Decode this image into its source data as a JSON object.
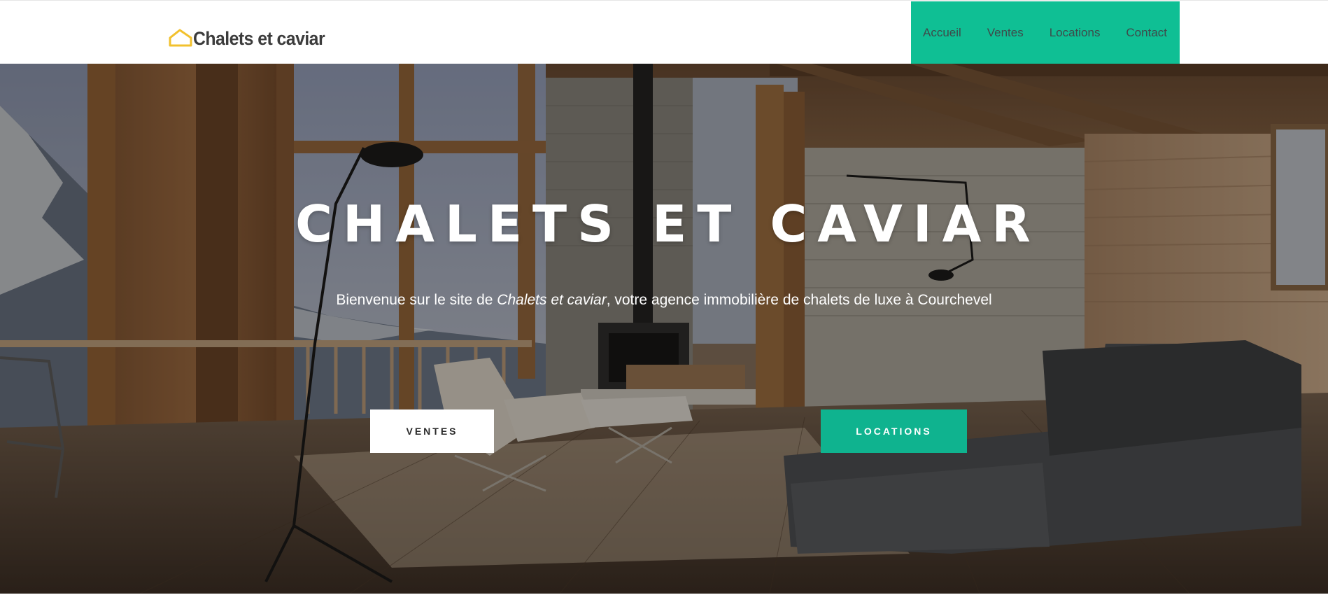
{
  "header": {
    "logo": {
      "text": "Chalets et caviar",
      "icon": "house-outline-icon",
      "icon_color": "#f2c12e"
    },
    "nav": {
      "background": "#0fbf94",
      "items": [
        {
          "label": "Accueil"
        },
        {
          "label": "Ventes"
        },
        {
          "label": "Locations"
        },
        {
          "label": "Contact"
        }
      ]
    }
  },
  "hero": {
    "title": "CHALETS ET CAVIAR",
    "subtitle_prefix": "Bienvenue sur le site de ",
    "subtitle_brand": "Chalets et caviar",
    "subtitle_suffix": ", votre agence immobilière de chalets de luxe à Courchevel",
    "buttons": {
      "ventes": "VENTES",
      "locations": "LOCATIONS"
    },
    "accent_color": "#0fb38f"
  }
}
